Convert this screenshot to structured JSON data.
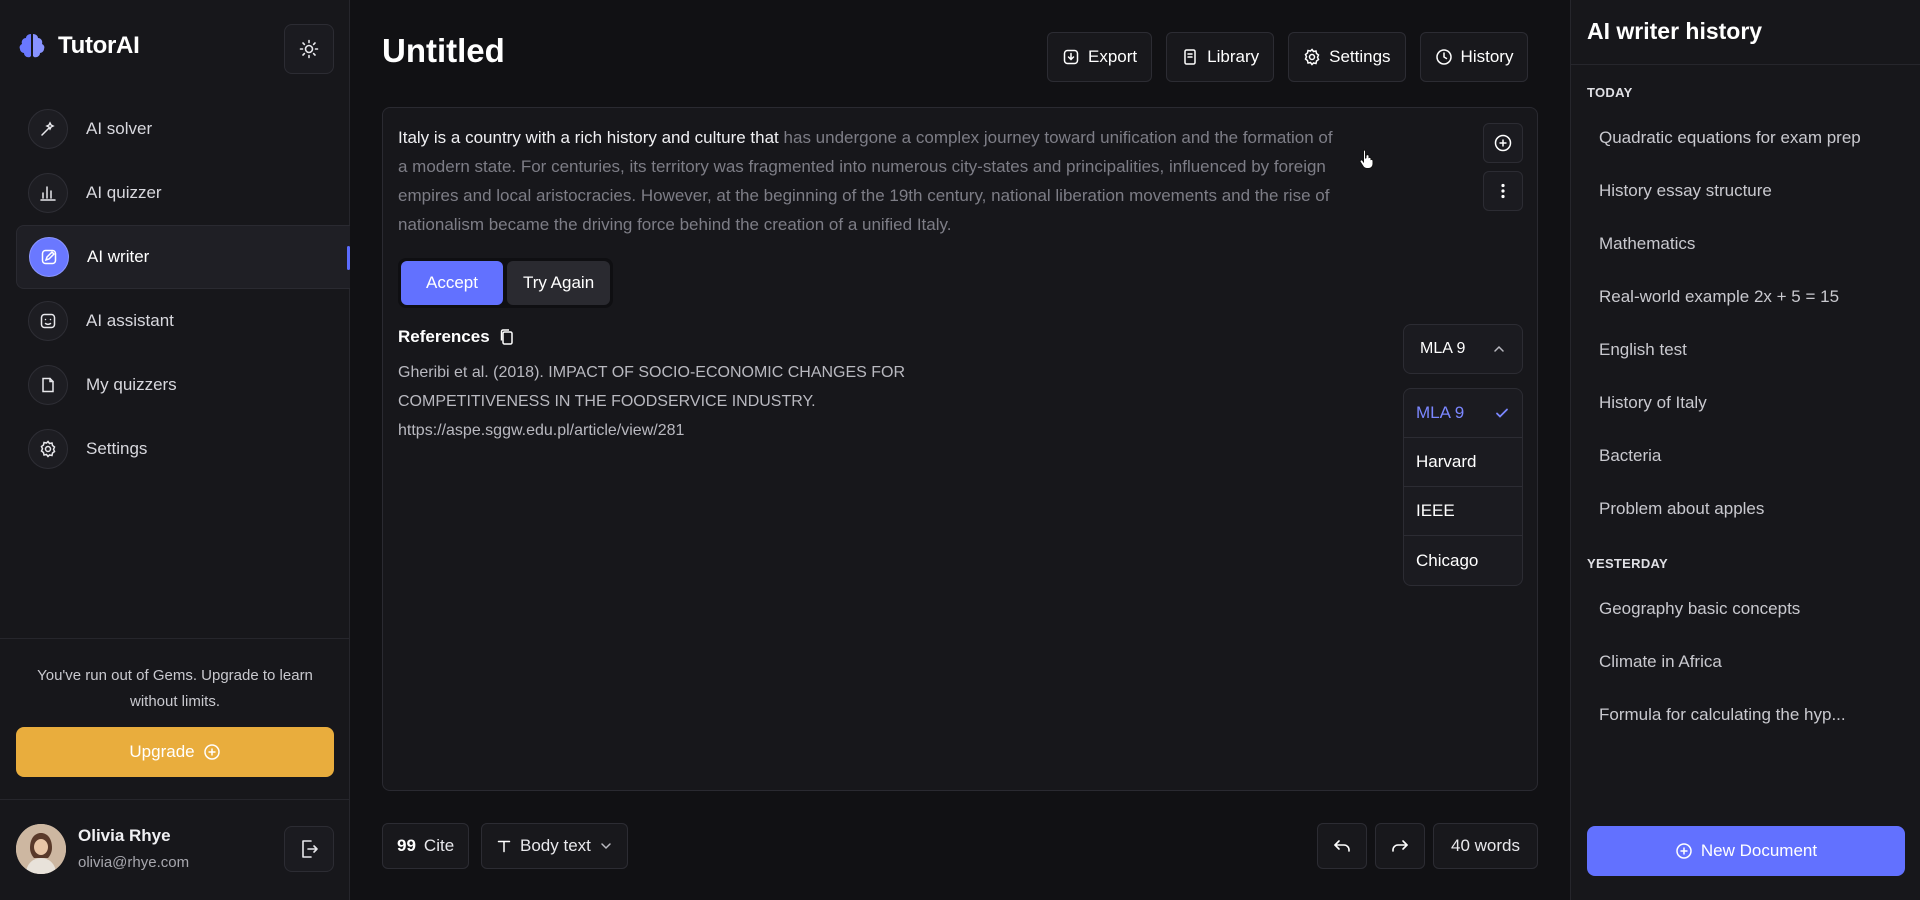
{
  "app": {
    "name": "TutorAI"
  },
  "sidebar": {
    "items": [
      {
        "label": "AI solver",
        "icon": "sparkle-wand-icon"
      },
      {
        "label": "AI quizzer",
        "icon": "bar-chart-icon"
      },
      {
        "label": "AI writer",
        "icon": "edit-icon",
        "active": true
      },
      {
        "label": "AI assistant",
        "icon": "robot-face-icon"
      },
      {
        "label": "My quizzers",
        "icon": "document-icon"
      },
      {
        "label": "Settings",
        "icon": "gear-icon"
      }
    ],
    "gems_message": "You've run out of Gems. Upgrade to learn without limits.",
    "upgrade_label": "Upgrade",
    "user": {
      "name": "Olivia Rhye",
      "email": "olivia@rhye.com"
    }
  },
  "document": {
    "title": "Untitled"
  },
  "toolbar": {
    "export_label": "Export",
    "library_label": "Library",
    "settings_label": "Settings",
    "history_label": "History"
  },
  "editor": {
    "accepted_text": "Italy is a country with a rich history and culture that",
    "suggested_text": "has undergone a complex journey toward unification and the formation of a modern state. For centuries, its territory was fragmented into numerous city-states and principalities, influenced by foreign empires and local aristocracies. However, at the beginning of the 19th century, national liberation movements and the rise of nationalism became the driving force behind the creation of a unified Italy.",
    "accept_label": "Accept",
    "try_again_label": "Try Again",
    "references_label": "References",
    "references_text": "Gheribi et al. (2018). IMPACT OF SOCIO-ECONOMIC CHANGES FOR COMPETITIVENESS IN THE FOODSERVICE INDUSTRY. https://aspe.sggw.edu.pl/article/view/281",
    "citation_style": {
      "selected": "MLA 9",
      "options": [
        "MLA 9",
        "Harvard",
        "IEEE",
        "Chicago"
      ]
    }
  },
  "bottom_bar": {
    "cite_label": "Cite",
    "format_label": "Body text",
    "word_count": "40 words"
  },
  "history": {
    "title": "AI writer history",
    "today_label": "TODAY",
    "today": [
      "Quadratic equations for exam prep",
      "History essay structure",
      "Mathematics",
      "Real-world example 2x + 5 = 15",
      "English test",
      "History of Italy",
      "Bacteria",
      "Problem about apples"
    ],
    "yesterday_label": "YESTERDAY",
    "yesterday": [
      "Geography basic concepts",
      "Climate in Africa",
      "Formula for calculating the hyp..."
    ],
    "new_document_label": "New Document"
  },
  "colors": {
    "accent": "#6271ff",
    "upgrade": "#e9ad3d",
    "background": "#111114",
    "panel": "#17171b"
  }
}
